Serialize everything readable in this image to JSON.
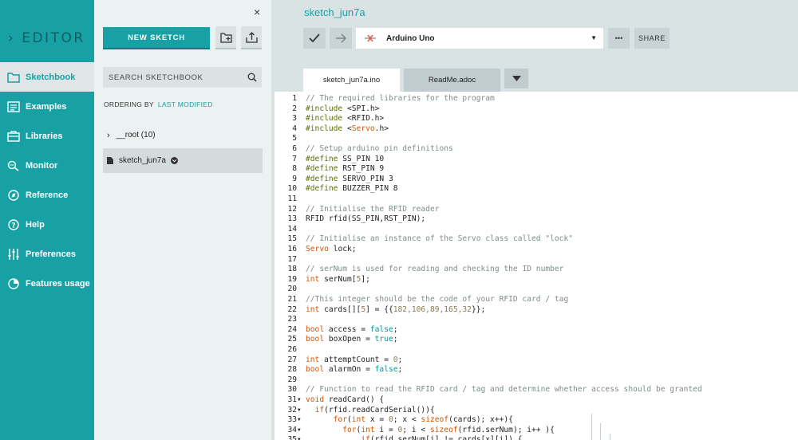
{
  "sidebar": {
    "logo": "EDITOR",
    "items": [
      {
        "label": "Sketchbook",
        "icon": "folder-icon"
      },
      {
        "label": "Examples",
        "icon": "examples-icon"
      },
      {
        "label": "Libraries",
        "icon": "libraries-icon"
      },
      {
        "label": "Monitor",
        "icon": "monitor-icon"
      },
      {
        "label": "Reference",
        "icon": "reference-icon"
      },
      {
        "label": "Help",
        "icon": "help-icon"
      },
      {
        "label": "Preferences",
        "icon": "preferences-icon"
      },
      {
        "label": "Features usage",
        "icon": "features-icon"
      }
    ],
    "active": "Sketchbook"
  },
  "panel": {
    "close": "×",
    "new_sketch": "NEW SKETCH",
    "search_placeholder": "SEARCH SKETCHBOOK",
    "ordering_label": "ORDERING BY",
    "ordering_value": "LAST MODIFIED",
    "tree": [
      {
        "label": "__root (10)"
      },
      {
        "label": "sketch_jun7a"
      }
    ]
  },
  "editor": {
    "title": "sketch_jun7a",
    "board": "Arduino Uno",
    "more": "•••",
    "share": "SHARE",
    "tabs": [
      {
        "label": "sketch_jun7a.ino"
      },
      {
        "label": "ReadMe.adoc"
      }
    ]
  },
  "code_lines": [
    {
      "n": "1",
      "t": "// The required libraries for the program"
    },
    {
      "n": "2",
      "t": "#include <SPI.h>"
    },
    {
      "n": "3",
      "t": "#include <RFID.h>"
    },
    {
      "n": "4",
      "t": "#include <Servo.h>"
    },
    {
      "n": "5",
      "t": ""
    },
    {
      "n": "6",
      "t": "// Setup arduino pin definitions"
    },
    {
      "n": "7",
      "t": "#define SS_PIN 10"
    },
    {
      "n": "8",
      "t": "#define RST_PIN 9"
    },
    {
      "n": "9",
      "t": "#define SERVO_PIN 3"
    },
    {
      "n": "10",
      "t": "#define BUZZER_PIN 8"
    },
    {
      "n": "11",
      "t": ""
    },
    {
      "n": "12",
      "t": "// Initialise the RFID reader"
    },
    {
      "n": "13",
      "t": "RFID rfid(SS_PIN,RST_PIN);"
    },
    {
      "n": "14",
      "t": ""
    },
    {
      "n": "15",
      "t": "// Initialise an instance of the Servo class called \"lock\""
    },
    {
      "n": "16",
      "t": "Servo lock;"
    },
    {
      "n": "17",
      "t": ""
    },
    {
      "n": "18",
      "t": "// serNum is used for reading and checking the ID number"
    },
    {
      "n": "19",
      "t": "int serNum[5];"
    },
    {
      "n": "20",
      "t": ""
    },
    {
      "n": "21",
      "t": "//This integer should be the code of your RFID card / tag"
    },
    {
      "n": "22",
      "t": "int cards[][5] = {{182,106,89,165,32}};"
    },
    {
      "n": "23",
      "t": ""
    },
    {
      "n": "24",
      "t": "bool access = false;"
    },
    {
      "n": "25",
      "t": "bool boxOpen = true;"
    },
    {
      "n": "26",
      "t": ""
    },
    {
      "n": "27",
      "t": "int attemptCount = 0;"
    },
    {
      "n": "28",
      "t": "bool alarmOn = false;"
    },
    {
      "n": "29",
      "t": ""
    },
    {
      "n": "30",
      "t": "// Function to read the RFID card / tag and determine whether access should be granted"
    },
    {
      "n": "31",
      "t": "void readCard() {",
      "fold": true
    },
    {
      "n": "32",
      "t": "  if(rfid.readCardSerial()){",
      "fold": true
    },
    {
      "n": "33",
      "t": "      for(int x = 0; x < sizeof(cards); x++){",
      "fold": true
    },
    {
      "n": "34",
      "t": "        for(int i = 0; i < sizeof(rfid.serNum); i++ ){",
      "fold": true
    },
    {
      "n": "35",
      "t": "            if(rfid.serNum[i] != cards[x][i]) {",
      "fold": true
    }
  ]
}
